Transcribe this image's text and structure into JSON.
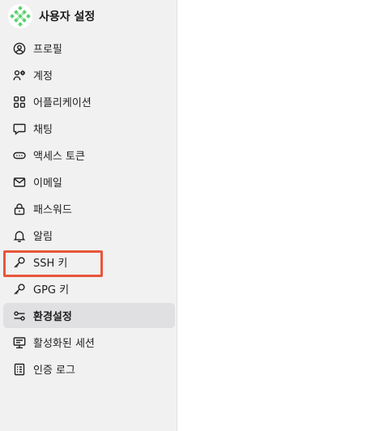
{
  "header": {
    "title": "사용자 설정",
    "logo_icon": "diamond-grid-logo",
    "logo_color": "#5ad06a"
  },
  "nav": {
    "items": [
      {
        "label": "프로필",
        "icon": "user-circle-icon"
      },
      {
        "label": "계정",
        "icon": "user-gear-icon"
      },
      {
        "label": "어플리케이션",
        "icon": "apps-grid-icon"
      },
      {
        "label": "채팅",
        "icon": "chat-bubble-icon"
      },
      {
        "label": "액세스 토큰",
        "icon": "token-icon"
      },
      {
        "label": "이메일",
        "icon": "mail-icon"
      },
      {
        "label": "패스워드",
        "icon": "lock-icon"
      },
      {
        "label": "알림",
        "icon": "bell-icon"
      },
      {
        "label": "SSH 키",
        "icon": "key-icon"
      },
      {
        "label": "GPG 키",
        "icon": "key-icon"
      },
      {
        "label": "환경설정",
        "icon": "preferences-icon",
        "active": true
      },
      {
        "label": "활성화된 세션",
        "icon": "monitor-icon"
      },
      {
        "label": "인증 로그",
        "icon": "log-icon"
      }
    ]
  },
  "highlight_color": "#e8553b"
}
